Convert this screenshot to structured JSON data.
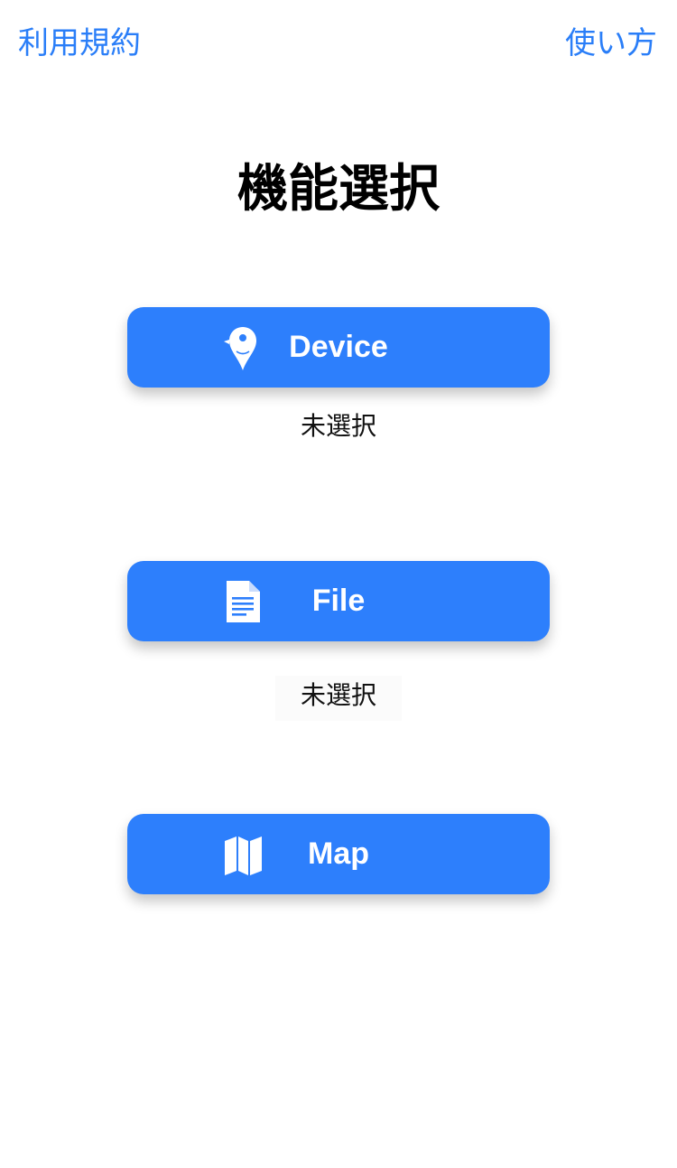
{
  "header": {
    "terms_label": "利用規約",
    "howto_label": "使い方"
  },
  "page": {
    "title": "機能選択"
  },
  "buttons": {
    "device": {
      "label": "Device",
      "icon": "location-pin-icon",
      "status": "未選択"
    },
    "file": {
      "label": "File",
      "icon": "document-icon",
      "status": "未選択"
    },
    "map": {
      "label": "Map",
      "icon": "map-icon"
    }
  },
  "colors": {
    "accent": "#2d7ffc",
    "link": "#2a7ef8",
    "button_text": "#ffffff"
  }
}
